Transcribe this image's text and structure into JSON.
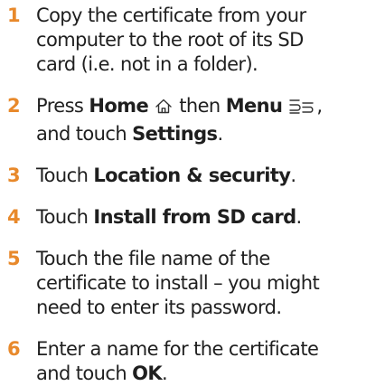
{
  "steps": [
    {
      "number": "1",
      "text": "Copy the certificate from your computer to the root of its SD card (i.e. not in a folder)."
    },
    {
      "number": "2",
      "parts": {
        "a": "Press ",
        "b": "Home",
        "c": " then ",
        "d": "Menu",
        "e": ", and touch ",
        "f": "Settings",
        "g": "."
      },
      "icons": [
        "home-icon",
        "menu-icon"
      ]
    },
    {
      "number": "3",
      "parts": {
        "a": "Touch ",
        "b": "Location & security",
        "c": "."
      }
    },
    {
      "number": "4",
      "parts": {
        "a": "Touch ",
        "b": "Install from SD card",
        "c": "."
      }
    },
    {
      "number": "5",
      "text": "Touch the file name of the certificate to install – you might need to enter its password."
    },
    {
      "number": "6",
      "parts": {
        "a": "Enter a name for the certificate and touch ",
        "b": "OK",
        "c": "."
      }
    }
  ],
  "colors": {
    "step_number": "#e8892b",
    "text": "#1f1f1f"
  }
}
